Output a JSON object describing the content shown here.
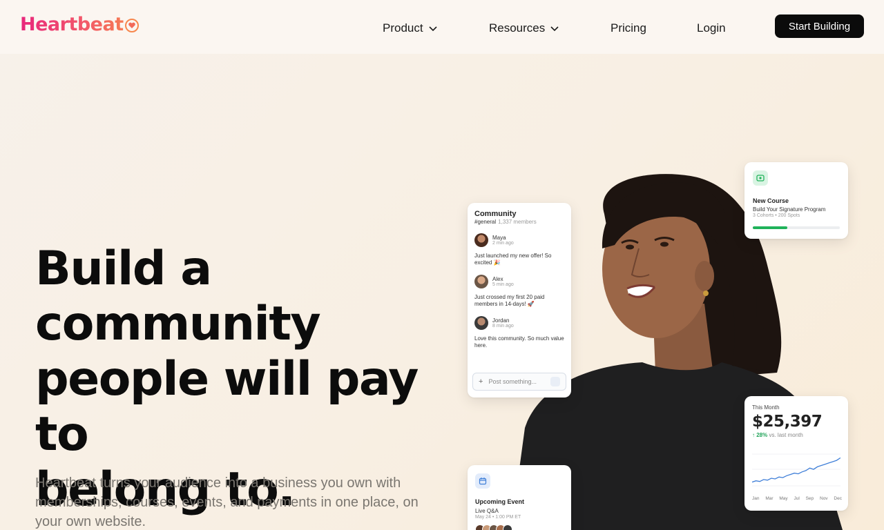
{
  "header": {
    "logo_text": "Heartbeat",
    "nav": [
      {
        "label": "Product",
        "has_dropdown": true
      },
      {
        "label": "Resources",
        "has_dropdown": true
      },
      {
        "label": "Pricing",
        "has_dropdown": false
      },
      {
        "label": "Login",
        "has_dropdown": false
      }
    ],
    "cta_label": "Start Building"
  },
  "hero": {
    "title_lines": [
      "Build a",
      "community",
      "people will pay to",
      "belong to."
    ],
    "subtitle": "Heartbeat turns your audience into a business you own with memberships, courses, events, and payments in one place, on your own website."
  },
  "community_card": {
    "title": "Community",
    "channel": "#general",
    "member_count": "1,337 members",
    "messages": [
      {
        "name": "Maya",
        "time": "2 min ago",
        "text": "Just launched my new offer! So excited 🎉"
      },
      {
        "name": "Alex",
        "time": "5 min ago",
        "text": "Just crossed my first 20 paid members in 14-days! 🚀"
      },
      {
        "name": "Jordan",
        "time": "8 min ago",
        "text": "Love this community. So much value here."
      }
    ],
    "post_placeholder": "Post something..."
  },
  "course_card": {
    "title": "New Course",
    "name": "Build Your Signature Program",
    "meta": "3 Cohorts • 200 Spots",
    "progress": 0.4
  },
  "revenue_card": {
    "label": "This Month",
    "value": "$25,397",
    "change": "↑ 28%",
    "change_suffix": "vs. last month"
  },
  "event_card": {
    "title": "Upcoming Event",
    "name": "Live Q&A",
    "meta": "May 24 • 1:00 PM ET"
  },
  "chart_data": {
    "type": "line",
    "categories": [
      "Jan",
      "Mar",
      "May",
      "Jul",
      "Sep",
      "Nov",
      "Dec"
    ],
    "series": [
      {
        "values": [
          12,
          13,
          12.5,
          14,
          13.5,
          15,
          14.5,
          16,
          15.5,
          17,
          18,
          19,
          18.5,
          20,
          21,
          23,
          22,
          24,
          25,
          26,
          27,
          28,
          29,
          31
        ]
      }
    ]
  },
  "colors": {
    "brand_pink": "#e8277c",
    "brand_orange": "#f7874d",
    "cta_bg": "#0b0b0b",
    "success": "#20b25a",
    "chart_line": "#3f7fd8"
  }
}
